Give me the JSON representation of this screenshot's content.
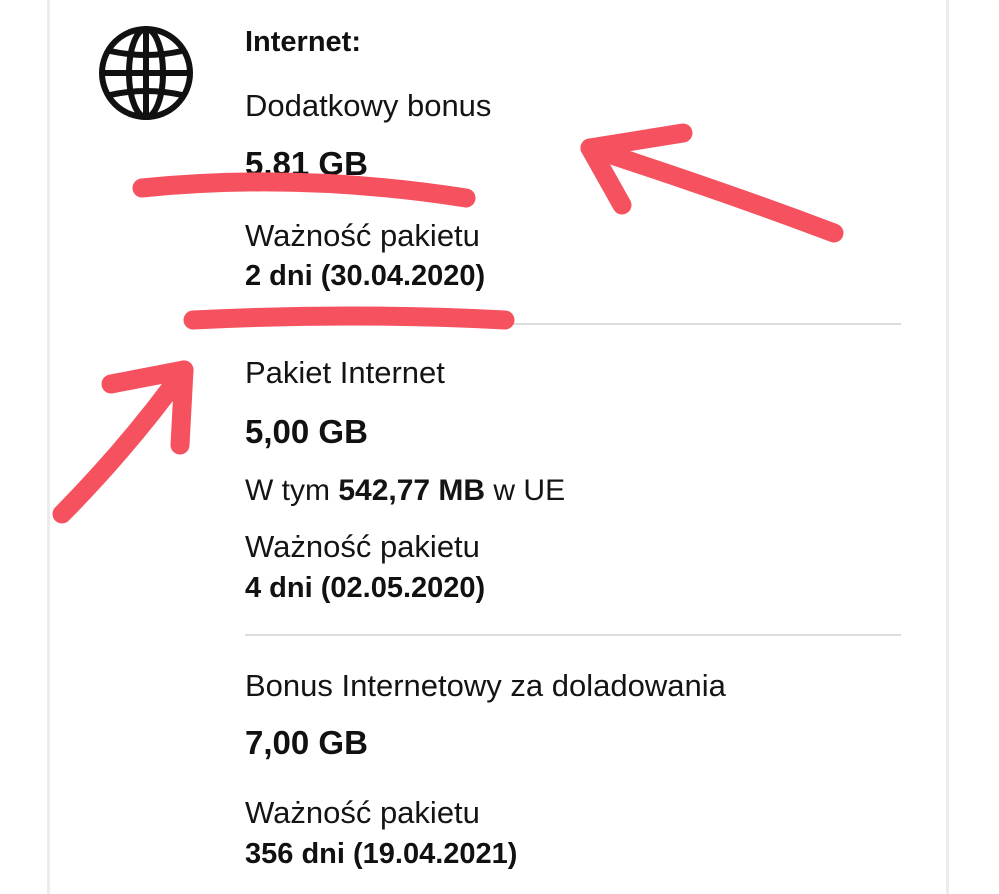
{
  "section": {
    "icon": "globe-icon",
    "title": "Internet:"
  },
  "items": [
    {
      "name": "Dodatkowy bonus",
      "amount": "5,81 GB",
      "validity_label": "Ważność pakietu",
      "validity": "2 dni (30.04.2020)"
    },
    {
      "name": "Pakiet Internet",
      "amount": "5,00 GB",
      "eu_prefix": "W tym",
      "eu_amount": "542,77 MB",
      "eu_suffix": "w UE",
      "validity_label": "Ważność pakietu",
      "validity": "4 dni (02.05.2020)"
    },
    {
      "name": "Bonus Internetowy za doladowania",
      "amount": "7,00 GB",
      "validity_label": "Ważność pakietu",
      "validity": "356 dni (19.04.2021)"
    }
  ],
  "annotation_color": "#f5515f"
}
